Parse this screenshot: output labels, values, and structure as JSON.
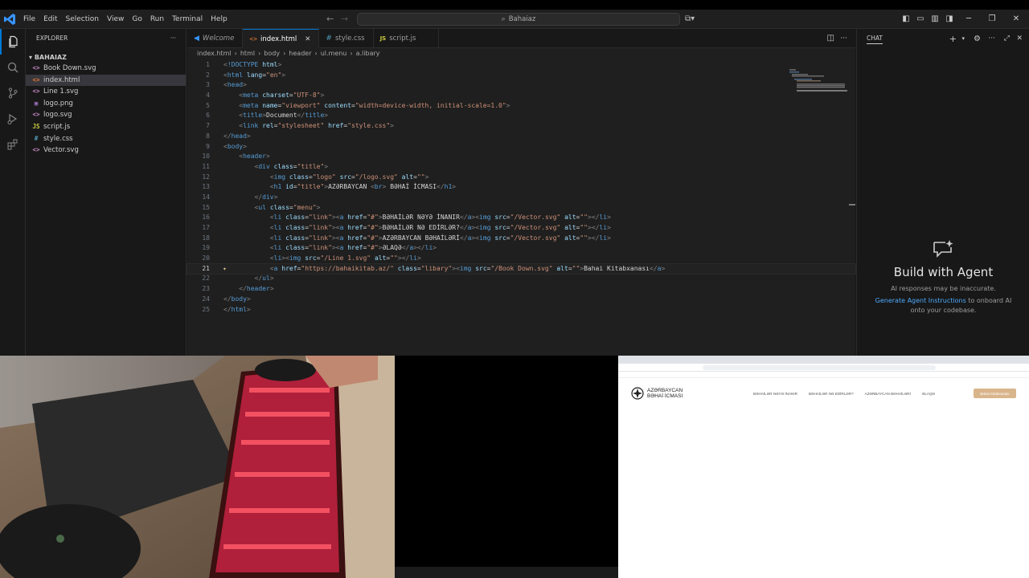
{
  "menu": [
    "File",
    "Edit",
    "Selection",
    "View",
    "Go",
    "Run",
    "Terminal",
    "Help"
  ],
  "search": {
    "text": "Bahaiaz"
  },
  "explorer": {
    "title": "EXPLORER",
    "folder": "BAHAIAZ",
    "files": [
      {
        "name": "Book Down.svg",
        "icon": "svg-icon",
        "glyph": "<>",
        "color": "#c586c0"
      },
      {
        "name": "index.html",
        "icon": "html-icon",
        "glyph": "<>",
        "color": "#e37933"
      },
      {
        "name": "Line 1.svg",
        "icon": "svg-icon",
        "glyph": "<>",
        "color": "#c586c0"
      },
      {
        "name": "logo.png",
        "icon": "image-icon",
        "glyph": "▣",
        "color": "#a074c4"
      },
      {
        "name": "logo.svg",
        "icon": "svg-icon",
        "glyph": "<>",
        "color": "#c586c0"
      },
      {
        "name": "script.js",
        "icon": "js-icon",
        "glyph": "JS",
        "color": "#cbcb41"
      },
      {
        "name": "style.css",
        "icon": "css-icon",
        "glyph": "#",
        "color": "#519aba"
      },
      {
        "name": "Vector.svg",
        "icon": "svg-icon",
        "glyph": "<>",
        "color": "#c586c0"
      }
    ]
  },
  "tabs": [
    {
      "label": "Welcome",
      "icon": "vscode-icon"
    },
    {
      "label": "index.html",
      "icon": "html-icon"
    },
    {
      "label": "style.css",
      "icon": "css-icon"
    },
    {
      "label": "script.js",
      "icon": "js-icon"
    }
  ],
  "breadcrumb": [
    "index.html",
    "html",
    "body",
    "header",
    "ul.menu",
    "a.libary"
  ],
  "code": [
    [
      [
        "p",
        "<"
      ],
      [
        "t",
        "!DOCTYPE"
      ],
      [
        "x",
        " "
      ],
      [
        "a",
        "html"
      ],
      [
        "p",
        ">"
      ]
    ],
    [
      [
        "p",
        "<"
      ],
      [
        "t",
        "html"
      ],
      [
        "x",
        " "
      ],
      [
        "a",
        "lang"
      ],
      [
        "x",
        "="
      ],
      [
        "s",
        "\"en\""
      ],
      [
        "p",
        ">"
      ]
    ],
    [
      [
        "p",
        "<"
      ],
      [
        "t",
        "head"
      ],
      [
        "p",
        ">"
      ]
    ],
    [
      [
        "x",
        "    "
      ],
      [
        "p",
        "<"
      ],
      [
        "t",
        "meta"
      ],
      [
        "x",
        " "
      ],
      [
        "a",
        "charset"
      ],
      [
        "x",
        "="
      ],
      [
        "s",
        "\"UTF-8\""
      ],
      [
        "p",
        ">"
      ]
    ],
    [
      [
        "x",
        "    "
      ],
      [
        "p",
        "<"
      ],
      [
        "t",
        "meta"
      ],
      [
        "x",
        " "
      ],
      [
        "a",
        "name"
      ],
      [
        "x",
        "="
      ],
      [
        "s",
        "\"viewport\""
      ],
      [
        "x",
        " "
      ],
      [
        "a",
        "content"
      ],
      [
        "x",
        "="
      ],
      [
        "s",
        "\"width=device-width, initial-scale=1.0\""
      ],
      [
        "p",
        ">"
      ]
    ],
    [
      [
        "x",
        "    "
      ],
      [
        "p",
        "<"
      ],
      [
        "t",
        "title"
      ],
      [
        "p",
        ">"
      ],
      [
        "x",
        "Document"
      ],
      [
        "p",
        "</"
      ],
      [
        "t",
        "title"
      ],
      [
        "p",
        ">"
      ]
    ],
    [
      [
        "x",
        "    "
      ],
      [
        "p",
        "<"
      ],
      [
        "t",
        "link"
      ],
      [
        "x",
        " "
      ],
      [
        "a",
        "rel"
      ],
      [
        "x",
        "="
      ],
      [
        "s",
        "\"stylesheet\""
      ],
      [
        "x",
        " "
      ],
      [
        "a",
        "href"
      ],
      [
        "x",
        "="
      ],
      [
        "s",
        "\"style.css\""
      ],
      [
        "p",
        ">"
      ]
    ],
    [
      [
        "p",
        "</"
      ],
      [
        "t",
        "head"
      ],
      [
        "p",
        ">"
      ]
    ],
    [
      [
        "p",
        "<"
      ],
      [
        "t",
        "body"
      ],
      [
        "p",
        ">"
      ]
    ],
    [
      [
        "x",
        "    "
      ],
      [
        "p",
        "<"
      ],
      [
        "t",
        "header"
      ],
      [
        "p",
        ">"
      ]
    ],
    [
      [
        "x",
        "        "
      ],
      [
        "p",
        "<"
      ],
      [
        "t",
        "div"
      ],
      [
        "x",
        " "
      ],
      [
        "a",
        "class"
      ],
      [
        "x",
        "="
      ],
      [
        "s",
        "\"title\""
      ],
      [
        "p",
        ">"
      ]
    ],
    [
      [
        "x",
        "            "
      ],
      [
        "p",
        "<"
      ],
      [
        "t",
        "img"
      ],
      [
        "x",
        " "
      ],
      [
        "a",
        "class"
      ],
      [
        "x",
        "="
      ],
      [
        "s",
        "\"logo\""
      ],
      [
        "x",
        " "
      ],
      [
        "a",
        "src"
      ],
      [
        "x",
        "="
      ],
      [
        "s",
        "\"/logo.svg\""
      ],
      [
        "x",
        " "
      ],
      [
        "a",
        "alt"
      ],
      [
        "x",
        "="
      ],
      [
        "s",
        "\"\""
      ],
      [
        "p",
        ">"
      ]
    ],
    [
      [
        "x",
        "            "
      ],
      [
        "p",
        "<"
      ],
      [
        "t",
        "h1"
      ],
      [
        "x",
        " "
      ],
      [
        "a",
        "id"
      ],
      [
        "x",
        "="
      ],
      [
        "s",
        "\"title\""
      ],
      [
        "p",
        ">"
      ],
      [
        "x",
        "AZƏRBAYCAN "
      ],
      [
        "p",
        "<"
      ],
      [
        "t",
        "br"
      ],
      [
        "p",
        ">"
      ],
      [
        "x",
        " BƏHAİ İCMASI"
      ],
      [
        "p",
        "</"
      ],
      [
        "t",
        "h1"
      ],
      [
        "p",
        ">"
      ]
    ],
    [
      [
        "x",
        "        "
      ],
      [
        "p",
        "</"
      ],
      [
        "t",
        "div"
      ],
      [
        "p",
        ">"
      ]
    ],
    [
      [
        "x",
        "        "
      ],
      [
        "p",
        "<"
      ],
      [
        "t",
        "ul"
      ],
      [
        "x",
        " "
      ],
      [
        "a",
        "class"
      ],
      [
        "x",
        "="
      ],
      [
        "s",
        "\"menu\""
      ],
      [
        "p",
        ">"
      ]
    ],
    [
      [
        "x",
        "            "
      ],
      [
        "p",
        "<"
      ],
      [
        "t",
        "li"
      ],
      [
        "x",
        " "
      ],
      [
        "a",
        "class"
      ],
      [
        "x",
        "="
      ],
      [
        "s",
        "\"link\""
      ],
      [
        "p",
        ">"
      ],
      [
        "p",
        "<"
      ],
      [
        "t",
        "a"
      ],
      [
        "x",
        " "
      ],
      [
        "a",
        "href"
      ],
      [
        "x",
        "="
      ],
      [
        "s",
        "\"#\""
      ],
      [
        "p",
        ">"
      ],
      [
        "x",
        "BƏHAİLƏR NƏYƏ İNANIR"
      ],
      [
        "p",
        "</"
      ],
      [
        "t",
        "a"
      ],
      [
        "p",
        ">"
      ],
      [
        "p",
        "<"
      ],
      [
        "t",
        "img"
      ],
      [
        "x",
        " "
      ],
      [
        "a",
        "src"
      ],
      [
        "x",
        "="
      ],
      [
        "s",
        "\"/Vector.svg\""
      ],
      [
        "x",
        " "
      ],
      [
        "a",
        "alt"
      ],
      [
        "x",
        "="
      ],
      [
        "s",
        "\"\""
      ],
      [
        "p",
        ">"
      ],
      [
        "p",
        "</"
      ],
      [
        "t",
        "li"
      ],
      [
        "p",
        ">"
      ]
    ],
    [
      [
        "x",
        "            "
      ],
      [
        "p",
        "<"
      ],
      [
        "t",
        "li"
      ],
      [
        "x",
        " "
      ],
      [
        "a",
        "class"
      ],
      [
        "x",
        "="
      ],
      [
        "s",
        "\"link\""
      ],
      [
        "p",
        ">"
      ],
      [
        "p",
        "<"
      ],
      [
        "t",
        "a"
      ],
      [
        "x",
        " "
      ],
      [
        "a",
        "href"
      ],
      [
        "x",
        "="
      ],
      [
        "s",
        "\"#\""
      ],
      [
        "p",
        ">"
      ],
      [
        "x",
        "BƏHAİLƏR NƏ EDİRLƏR?"
      ],
      [
        "p",
        "</"
      ],
      [
        "t",
        "a"
      ],
      [
        "p",
        ">"
      ],
      [
        "p",
        "<"
      ],
      [
        "t",
        "img"
      ],
      [
        "x",
        " "
      ],
      [
        "a",
        "src"
      ],
      [
        "x",
        "="
      ],
      [
        "s",
        "\"/Vector.svg\""
      ],
      [
        "x",
        " "
      ],
      [
        "a",
        "alt"
      ],
      [
        "x",
        "="
      ],
      [
        "s",
        "\"\""
      ],
      [
        "p",
        ">"
      ],
      [
        "p",
        "</"
      ],
      [
        "t",
        "li"
      ],
      [
        "p",
        ">"
      ]
    ],
    [
      [
        "x",
        "            "
      ],
      [
        "p",
        "<"
      ],
      [
        "t",
        "li"
      ],
      [
        "x",
        " "
      ],
      [
        "a",
        "class"
      ],
      [
        "x",
        "="
      ],
      [
        "s",
        "\"link\""
      ],
      [
        "p",
        ">"
      ],
      [
        "p",
        "<"
      ],
      [
        "t",
        "a"
      ],
      [
        "x",
        " "
      ],
      [
        "a",
        "href"
      ],
      [
        "x",
        "="
      ],
      [
        "s",
        "\"#\""
      ],
      [
        "p",
        ">"
      ],
      [
        "x",
        "AZƏRBAYCAN BƏHAİLƏRİ"
      ],
      [
        "p",
        "</"
      ],
      [
        "t",
        "a"
      ],
      [
        "p",
        ">"
      ],
      [
        "p",
        "<"
      ],
      [
        "t",
        "img"
      ],
      [
        "x",
        " "
      ],
      [
        "a",
        "src"
      ],
      [
        "x",
        "="
      ],
      [
        "s",
        "\"/Vector.svg\""
      ],
      [
        "x",
        " "
      ],
      [
        "a",
        "alt"
      ],
      [
        "x",
        "="
      ],
      [
        "s",
        "\"\""
      ],
      [
        "p",
        ">"
      ],
      [
        "p",
        "</"
      ],
      [
        "t",
        "li"
      ],
      [
        "p",
        ">"
      ]
    ],
    [
      [
        "x",
        "            "
      ],
      [
        "p",
        "<"
      ],
      [
        "t",
        "li"
      ],
      [
        "x",
        " "
      ],
      [
        "a",
        "class"
      ],
      [
        "x",
        "="
      ],
      [
        "s",
        "\"link\""
      ],
      [
        "p",
        ">"
      ],
      [
        "p",
        "<"
      ],
      [
        "t",
        "a"
      ],
      [
        "x",
        " "
      ],
      [
        "a",
        "href"
      ],
      [
        "x",
        "="
      ],
      [
        "s",
        "\"#\""
      ],
      [
        "p",
        ">"
      ],
      [
        "x",
        "ƏLAQƏ"
      ],
      [
        "p",
        "</"
      ],
      [
        "t",
        "a"
      ],
      [
        "p",
        ">"
      ],
      [
        "p",
        "</"
      ],
      [
        "t",
        "li"
      ],
      [
        "p",
        ">"
      ]
    ],
    [
      [
        "x",
        "            "
      ],
      [
        "p",
        "<"
      ],
      [
        "t",
        "li"
      ],
      [
        "p",
        ">"
      ],
      [
        "p",
        "<"
      ],
      [
        "t",
        "img"
      ],
      [
        "x",
        " "
      ],
      [
        "a",
        "src"
      ],
      [
        "x",
        "="
      ],
      [
        "s",
        "\"/Line 1.svg\""
      ],
      [
        "x",
        " "
      ],
      [
        "a",
        "alt"
      ],
      [
        "x",
        "="
      ],
      [
        "s",
        "\"\""
      ],
      [
        "p",
        ">"
      ],
      [
        "p",
        "</"
      ],
      [
        "t",
        "li"
      ],
      [
        "p",
        ">"
      ]
    ],
    [
      [
        "x",
        "            "
      ],
      [
        "p",
        "<"
      ],
      [
        "t",
        "a"
      ],
      [
        "x",
        " "
      ],
      [
        "a",
        "href"
      ],
      [
        "x",
        "="
      ],
      [
        "s",
        "\"https://bahaikitab.az/\""
      ],
      [
        "x",
        " "
      ],
      [
        "a",
        "class"
      ],
      [
        "x",
        "="
      ],
      [
        "s",
        "\"libary\""
      ],
      [
        "p",
        ">"
      ],
      [
        "p",
        "<"
      ],
      [
        "t",
        "img"
      ],
      [
        "x",
        " "
      ],
      [
        "a",
        "src"
      ],
      [
        "x",
        "="
      ],
      [
        "s",
        "\"/Book Down.svg\""
      ],
      [
        "x",
        " "
      ],
      [
        "a",
        "alt"
      ],
      [
        "x",
        "="
      ],
      [
        "s",
        "\"\""
      ],
      [
        "p",
        ">"
      ],
      [
        "x",
        "Bahai Kitabxanası"
      ],
      [
        "p",
        "</"
      ],
      [
        "t",
        "a"
      ],
      [
        "p",
        ">"
      ]
    ],
    [
      [
        "x",
        "        "
      ],
      [
        "p",
        "</"
      ],
      [
        "t",
        "ul"
      ],
      [
        "p",
        ">"
      ]
    ],
    [
      [
        "x",
        "    "
      ],
      [
        "p",
        "</"
      ],
      [
        "t",
        "header"
      ],
      [
        "p",
        ">"
      ]
    ],
    [
      [
        "p",
        "</"
      ],
      [
        "t",
        "body"
      ],
      [
        "p",
        ">"
      ]
    ],
    [
      [
        "p",
        "</"
      ],
      [
        "t",
        "html"
      ],
      [
        "p",
        ">"
      ]
    ]
  ],
  "current_line": 21,
  "chat": {
    "title": "CHAT",
    "heading": "Build with Agent",
    "disclaimer": "AI responses may be inaccurate.",
    "link": "Generate Agent Instructions",
    "rest": "to onboard AI onto your codebase."
  },
  "website": {
    "logo_line1": "AZƏRBAYCAN",
    "logo_line2": "BƏHAİ İCMASI",
    "nav": [
      "BƏHAİLƏR NƏYƏ İNANIR",
      "BƏHAİLƏR NƏ EDİRLƏR?",
      "AZƏRBAYCAN BƏHAİLƏRİ",
      "ƏLAQƏ"
    ],
    "button": "Bahai Kitabxanası"
  }
}
